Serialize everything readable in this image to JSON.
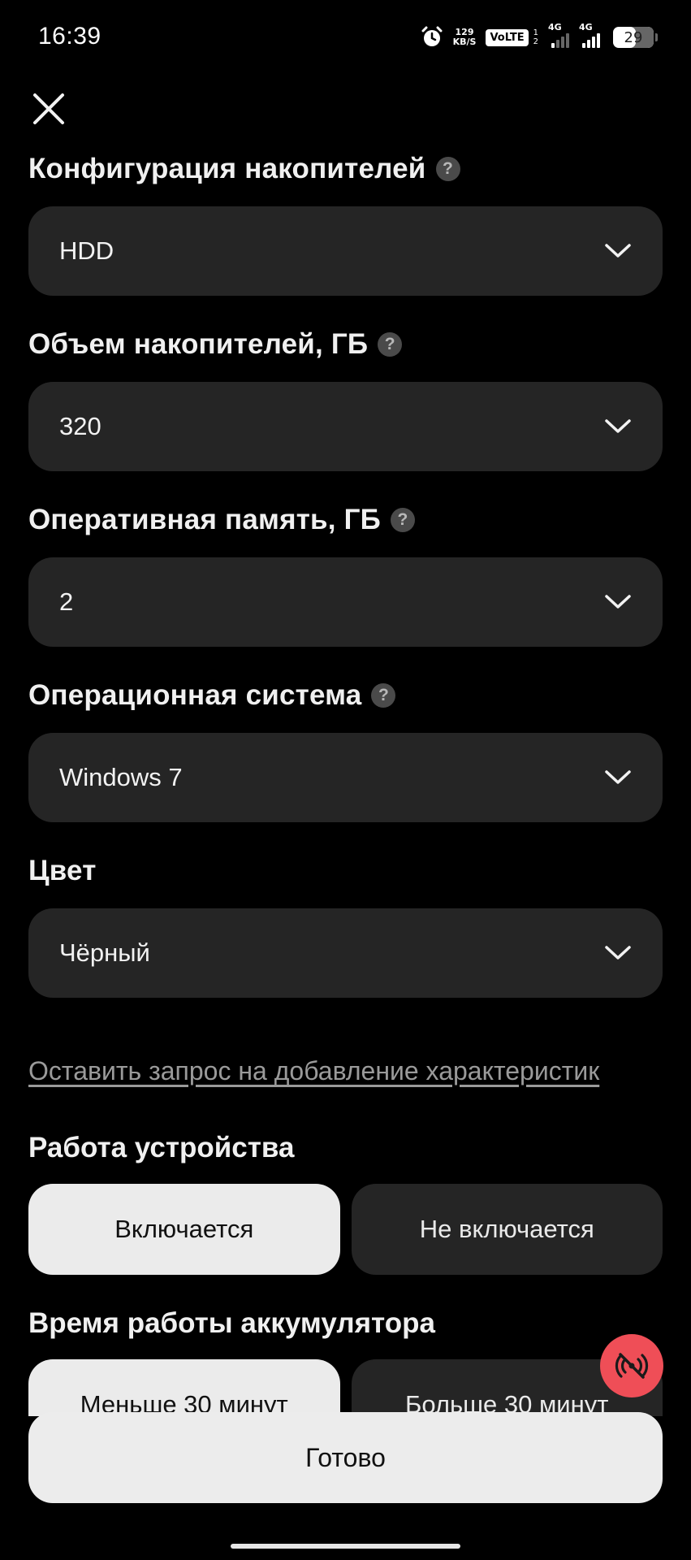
{
  "status_bar": {
    "time": "16:39",
    "net_speed_value": "129",
    "net_speed_unit": "KB/S",
    "volte": "VoLTE",
    "sim_top": "1",
    "sim_bottom": "2",
    "network_1": "4G",
    "network_2": "4G",
    "battery": "29"
  },
  "fields": [
    {
      "label": "Конфигурация накопителей",
      "value": "HDD",
      "has_help": true
    },
    {
      "label": "Объем накопителей, ГБ",
      "value": "320",
      "has_help": true
    },
    {
      "label": "Оперативная память, ГБ",
      "value": "2",
      "has_help": true
    },
    {
      "label": "Операционная система",
      "value": "Windows 7",
      "has_help": true
    },
    {
      "label": "Цвет",
      "value": "Чёрный",
      "has_help": false
    }
  ],
  "help_glyph": "?",
  "request_link": "Оставить запрос на добавление характеристик",
  "device_work": {
    "title": "Работа устройства",
    "options": [
      "Включается",
      "Не включается"
    ],
    "selected": "Включается"
  },
  "battery_time": {
    "title": "Время работы аккумулятора",
    "options": [
      "Меньше 30 минут",
      "Больше 30 минут"
    ]
  },
  "done_button": "Готово",
  "icons": {
    "close": "close-icon",
    "chevron": "chevron-down-icon",
    "help": "help-icon",
    "fab": "no-signal-icon"
  },
  "colors": {
    "background": "#000000",
    "field_bg": "#252525",
    "active_toggle": "#ebebeb",
    "fab": "#ef4e57"
  }
}
